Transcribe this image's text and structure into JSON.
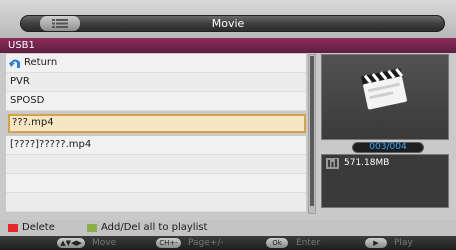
{
  "window": {
    "title": "Movie"
  },
  "source": {
    "label": "USB1"
  },
  "list": {
    "items": [
      {
        "label": "Return",
        "icon": "return-arrow-icon"
      },
      {
        "label": "PVR"
      },
      {
        "label": "SPOSD"
      },
      {
        "label": "???.mp4",
        "selected": true
      },
      {
        "label": "[????]?????.mp4"
      }
    ]
  },
  "preview": {
    "icon": "clapperboard-icon",
    "counter": "003/004",
    "file_size": "571.18MB",
    "file_size_icon": "file-size-icon"
  },
  "legend": {
    "delete_label": "Delete",
    "playlist_label": "Add/Del all to playlist",
    "delete_color": "#e0282b",
    "playlist_color": "#8bb04a"
  },
  "hints": [
    {
      "key": "▲▼◀▶",
      "label": "Move"
    },
    {
      "key": "CH+-",
      "label": "Page+/-"
    },
    {
      "key": "Ok",
      "label": "Enter"
    },
    {
      "key": "▶",
      "label": "Play"
    }
  ],
  "colors": {
    "accent_bar": "#8e2a5a",
    "selection_border": "#d4a24c",
    "counter_text": "#39a8ff"
  }
}
